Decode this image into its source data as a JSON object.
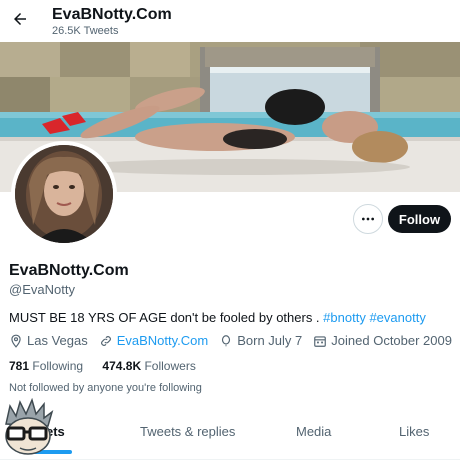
{
  "header": {
    "title": "EvaBNotty.Com",
    "tweet_count": "26.5K Tweets",
    "back_icon": "arrow-left-icon"
  },
  "profile": {
    "display_name": "EvaBNotty.Com",
    "handle": "@EvaNotty",
    "bio_text": "MUST BE 18 YRS OF AGE don't be fooled by others . ",
    "bio_hashtag_1": "#bnotty",
    "bio_hashtag_2": "#evanotty",
    "location": "Las Vegas",
    "website": "EvaBNotty.Com",
    "birthday": "Born July 7",
    "joined": "Joined October 2009",
    "following_count": "781",
    "following_label": "Following",
    "followers_count": "474.8K",
    "followers_label": "Followers",
    "not_followed_text": "Not followed by anyone you're following"
  },
  "actions": {
    "more_icon": "more-horizontal-icon",
    "follow_label": "Follow"
  },
  "tabs": [
    {
      "label": "Tweets",
      "visible_text": "ets",
      "active": true
    },
    {
      "label": "Tweets & replies",
      "active": false
    },
    {
      "label": "Media",
      "active": false
    },
    {
      "label": "Likes",
      "active": false
    }
  ],
  "colors": {
    "accent": "#1d9bf0",
    "text_primary": "#0f1419",
    "text_secondary": "#536471",
    "follow_button": "#0f1419"
  }
}
